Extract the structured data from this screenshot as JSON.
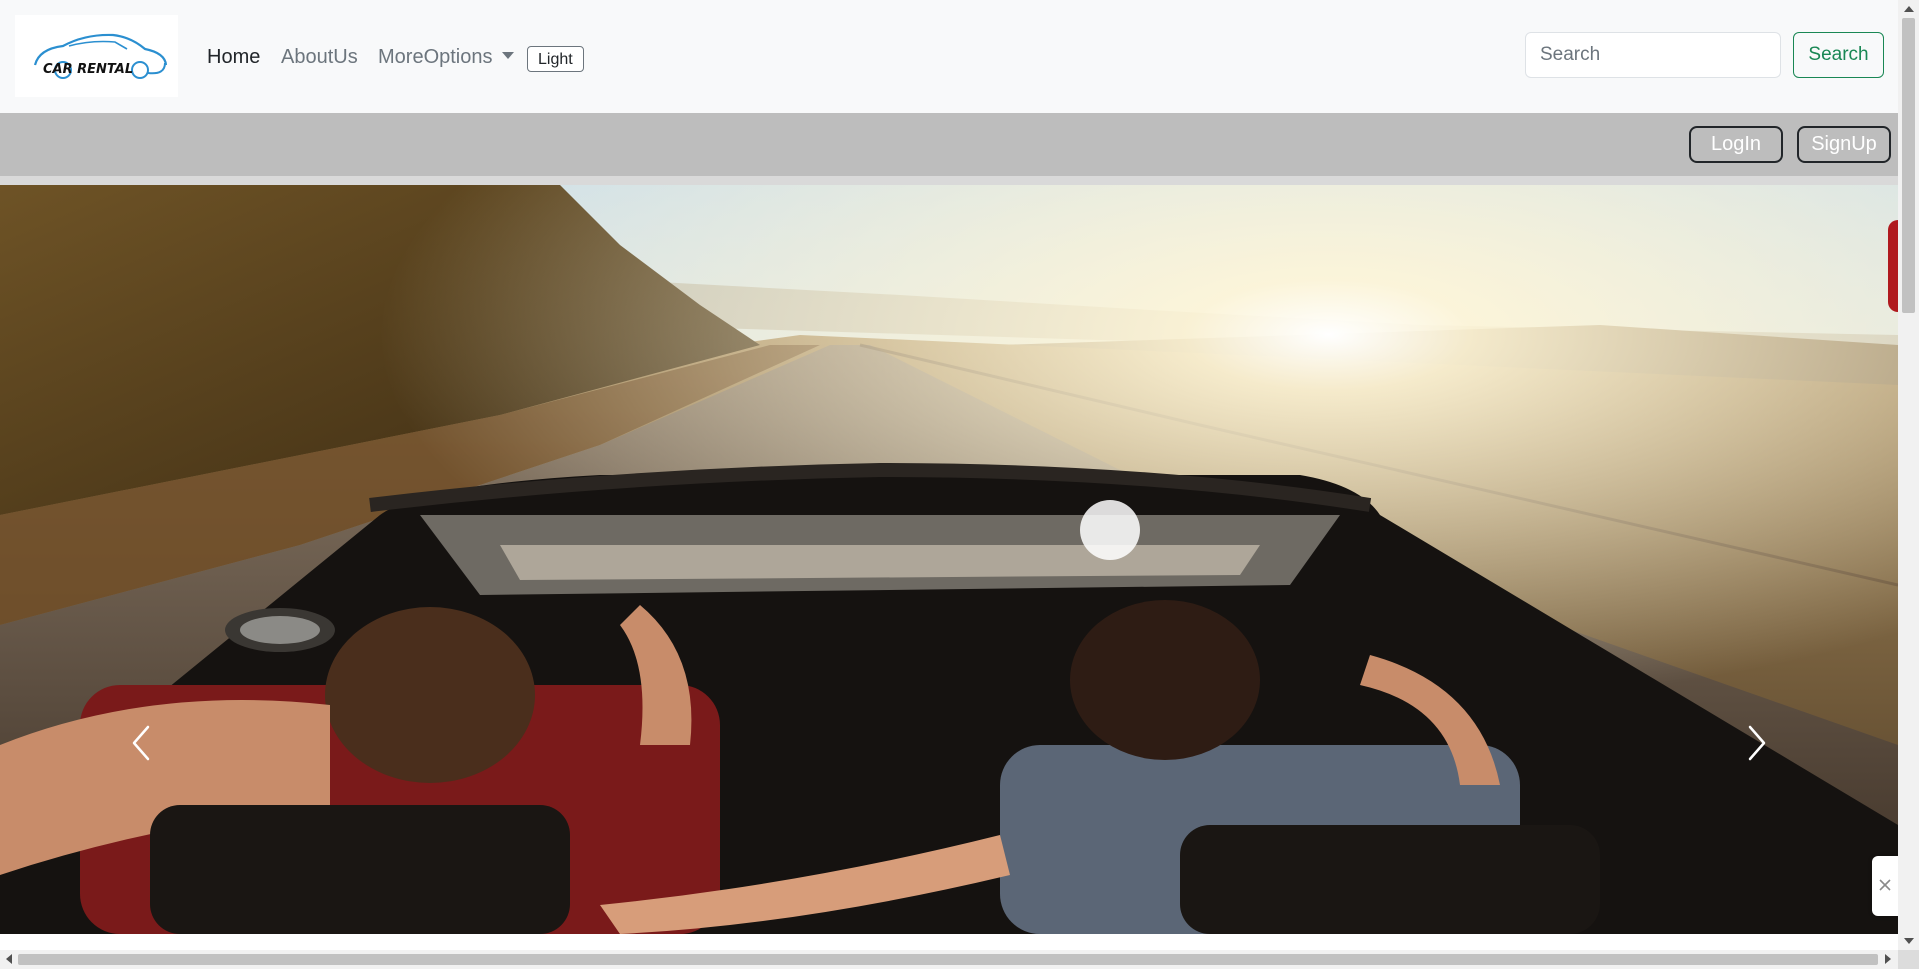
{
  "brand": {
    "logo_text": "CAR RENTAL"
  },
  "nav": {
    "items": [
      {
        "label": "Home"
      },
      {
        "label": "AboutUs"
      },
      {
        "label": "MoreOptions"
      }
    ],
    "theme_toggle_label": "Light"
  },
  "search": {
    "placeholder": "Search",
    "button_label": "Search"
  },
  "auth": {
    "login_label": "LogIn",
    "signup_label": "SignUp"
  },
  "carousel": {
    "prev_icon": "chevron-left-icon",
    "next_icon": "chevron-right-icon"
  },
  "colors": {
    "navbar_bg": "#f8f9fa",
    "authbar_bg": "#bdbdbd",
    "search_accent": "#198754",
    "side_tab": "#b0191e"
  }
}
